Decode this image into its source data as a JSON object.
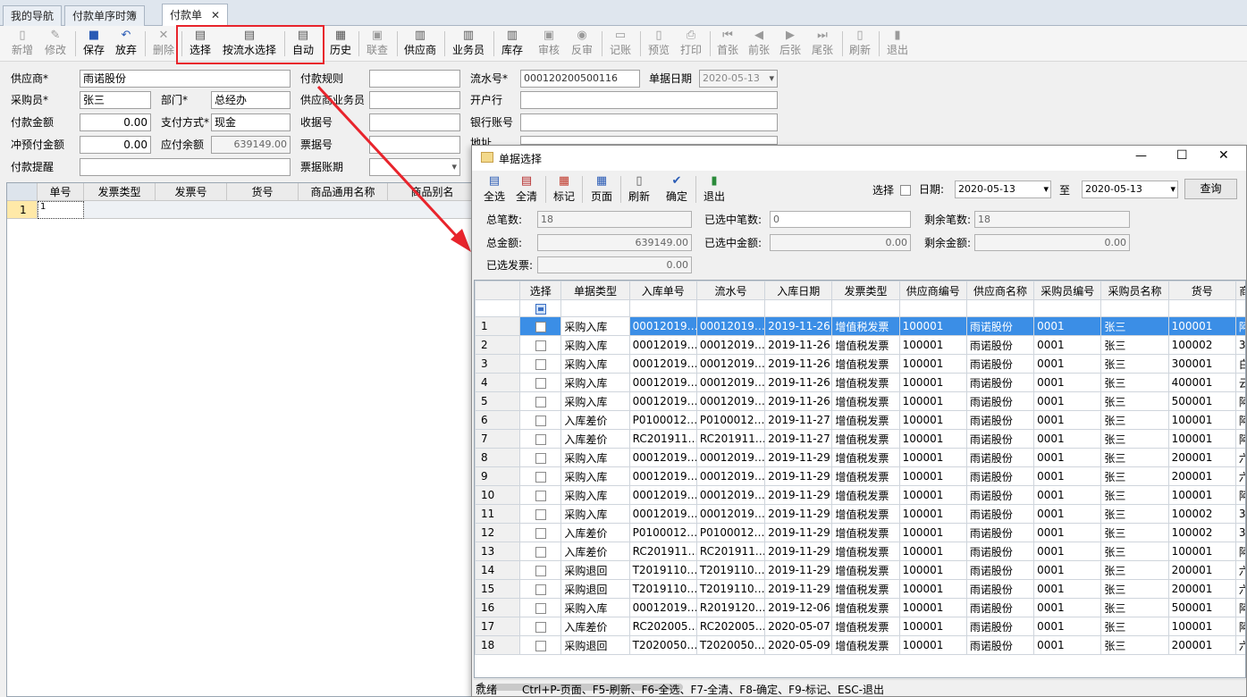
{
  "tabs": [
    {
      "label": "我的导航"
    },
    {
      "label": "付款单序时簿"
    },
    {
      "label": "付款单",
      "close": "✕"
    }
  ],
  "toolbar": {
    "items": [
      {
        "label": "新增",
        "icon": "new-doc-icon"
      },
      {
        "label": "修改",
        "icon": "edit-doc-icon"
      },
      {
        "label": "保存",
        "icon": "save-icon"
      },
      {
        "label": "放弃",
        "icon": "undo-icon"
      },
      {
        "label": "删除",
        "icon": "delete-icon"
      },
      {
        "label": "选择",
        "icon": "select-icon"
      },
      {
        "label": "按流水选择",
        "icon": "select-serial-icon"
      },
      {
        "label": "自动",
        "icon": "auto-icon"
      },
      {
        "label": "历史",
        "icon": "history-icon"
      },
      {
        "label": "联查",
        "icon": "link-query-icon"
      },
      {
        "label": "供应商",
        "icon": "supplier-icon"
      },
      {
        "label": "业务员",
        "icon": "salesman-icon"
      },
      {
        "label": "库存",
        "icon": "stock-icon"
      },
      {
        "label": "审核",
        "icon": "audit-icon"
      },
      {
        "label": "反审",
        "icon": "unaudit-icon"
      },
      {
        "label": "记账",
        "icon": "post-icon"
      },
      {
        "label": "预览",
        "icon": "preview-icon"
      },
      {
        "label": "打印",
        "icon": "print-icon"
      },
      {
        "label": "首张",
        "icon": "first-icon"
      },
      {
        "label": "前张",
        "icon": "prev-icon"
      },
      {
        "label": "后张",
        "icon": "next-icon"
      },
      {
        "label": "尾张",
        "icon": "last-icon"
      },
      {
        "label": "刷新",
        "icon": "refresh-icon"
      },
      {
        "label": "退出",
        "icon": "exit-icon"
      }
    ]
  },
  "form": {
    "supplier_label": "供应商*",
    "supplier_value": "雨诺股份",
    "pay_rule_label": "付款规则",
    "pay_rule_value": "",
    "serial_label": "流水号*",
    "serial_value": "000120200500116",
    "date_label": "单据日期",
    "date_value": "2020-05-13",
    "buyer_label": "采购员*",
    "buyer_value": "张三",
    "dept_label": "部门*",
    "dept_value": "总经办",
    "supplier_sales_label": "供应商业务员",
    "supplier_sales_value": "",
    "bank_label": "开户行",
    "bank_value": "",
    "amount_label": "付款金额",
    "amount_value": "0.00",
    "pay_method_label": "支付方式*",
    "pay_method_value": "现金",
    "receipt_label": "收据号",
    "receipt_value": "",
    "bank_account_label": "银行账号",
    "bank_account_value": "",
    "offset_label": "冲预付金额",
    "offset_value": "0.00",
    "payable_label": "应付余额",
    "payable_value": "639149.00",
    "bill_no_label": "票据号",
    "bill_no_value": "",
    "address_label": "地址",
    "address_value": "",
    "reminder_label": "付款提醒",
    "reminder_value": "",
    "bill_period_label": "票据账期",
    "bill_period_value": ""
  },
  "left_grid": {
    "columns": [
      "单号",
      "发票类型",
      "发票号",
      "货号",
      "商品通用名称",
      "商品别名"
    ],
    "rows": [
      {
        "num": "1",
        "cell": "1"
      }
    ]
  },
  "dialog": {
    "title": "单据选择",
    "window_controls": {
      "minimize": "—",
      "maximize": "☐",
      "close": "✕"
    },
    "toolbar": [
      {
        "label": "全选",
        "icon": "select-all-icon"
      },
      {
        "label": "全清",
        "icon": "clear-all-icon"
      },
      {
        "label": "标记",
        "icon": "mark-icon"
      },
      {
        "label": "页面",
        "icon": "page-icon"
      },
      {
        "label": "刷新",
        "icon": "refresh-icon"
      },
      {
        "label": "确定",
        "icon": "confirm-icon"
      },
      {
        "label": "退出",
        "icon": "exit-icon"
      }
    ],
    "select_label": "选择",
    "date_label": "日期:",
    "date_from": "2020-05-13",
    "to_label": "至",
    "date_to": "2020-05-13",
    "query_label": "查询",
    "total_count_label": "总笔数:",
    "total_count": "18",
    "selected_count_label": "已选中笔数:",
    "selected_count": "0",
    "remain_count_label": "剩余笔数:",
    "remain_count": "18",
    "total_amount_label": "总金额:",
    "total_amount": "639149.00",
    "selected_amount_label": "已选中金额:",
    "selected_amount": "0.00",
    "remain_amount_label": "剩余金额:",
    "remain_amount": "0.00",
    "selected_invoice_label": "已选发票:",
    "selected_invoice": "0.00",
    "columns": [
      "选择",
      "单据类型",
      "入库单号",
      "流水号",
      "入库日期",
      "发票类型",
      "供应商编号",
      "供应商名称",
      "采购员编号",
      "采购员名称",
      "货号",
      "商"
    ],
    "rows": [
      {
        "n": "1",
        "type": "采购入库",
        "in_no": "00012019…",
        "serial": "00012019…",
        "date": "2019-11-26",
        "inv": "增值税发票",
        "sup_code": "100001",
        "sup_name": "雨诺股份",
        "buyer_code": "0001",
        "buyer_name": "张三",
        "item": "100001",
        "extra": "阿"
      },
      {
        "n": "2",
        "type": "采购入库",
        "in_no": "00012019…",
        "serial": "00012019…",
        "date": "2019-11-26",
        "inv": "增值税发票",
        "sup_code": "100001",
        "sup_name": "雨诺股份",
        "buyer_code": "0001",
        "buyer_name": "张三",
        "item": "100002",
        "extra": "30"
      },
      {
        "n": "3",
        "type": "采购入库",
        "in_no": "00012019…",
        "serial": "00012019…",
        "date": "2019-11-26",
        "inv": "增值税发票",
        "sup_code": "100001",
        "sup_name": "雨诺股份",
        "buyer_code": "0001",
        "buyer_name": "张三",
        "item": "300001",
        "extra": "白"
      },
      {
        "n": "4",
        "type": "采购入库",
        "in_no": "00012019…",
        "serial": "00012019…",
        "date": "2019-11-26",
        "inv": "增值税发票",
        "sup_code": "100001",
        "sup_name": "雨诺股份",
        "buyer_code": "0001",
        "buyer_name": "张三",
        "item": "400001",
        "extra": "云"
      },
      {
        "n": "5",
        "type": "采购入库",
        "in_no": "00012019…",
        "serial": "00012019…",
        "date": "2019-11-26",
        "inv": "增值税发票",
        "sup_code": "100001",
        "sup_name": "雨诺股份",
        "buyer_code": "0001",
        "buyer_name": "张三",
        "item": "500001",
        "extra": "阿"
      },
      {
        "n": "6",
        "type": "入库差价",
        "in_no": "P0100012…",
        "serial": "P0100012…",
        "date": "2019-11-27",
        "inv": "增值税发票",
        "sup_code": "100001",
        "sup_name": "雨诺股份",
        "buyer_code": "0001",
        "buyer_name": "张三",
        "item": "100001",
        "extra": "阿"
      },
      {
        "n": "7",
        "type": "入库差价",
        "in_no": "RC201911…",
        "serial": "RC201911…",
        "date": "2019-11-27",
        "inv": "增值税发票",
        "sup_code": "100001",
        "sup_name": "雨诺股份",
        "buyer_code": "0001",
        "buyer_name": "张三",
        "item": "100001",
        "extra": "阿"
      },
      {
        "n": "8",
        "type": "采购入库",
        "in_no": "00012019…",
        "serial": "00012019…",
        "date": "2019-11-29",
        "inv": "增值税发票",
        "sup_code": "100001",
        "sup_name": "雨诺股份",
        "buyer_code": "0001",
        "buyer_name": "张三",
        "item": "200001",
        "extra": "六"
      },
      {
        "n": "9",
        "type": "采购入库",
        "in_no": "00012019…",
        "serial": "00012019…",
        "date": "2019-11-29",
        "inv": "增值税发票",
        "sup_code": "100001",
        "sup_name": "雨诺股份",
        "buyer_code": "0001",
        "buyer_name": "张三",
        "item": "200001",
        "extra": "六"
      },
      {
        "n": "10",
        "type": "采购入库",
        "in_no": "00012019…",
        "serial": "00012019…",
        "date": "2019-11-29",
        "inv": "增值税发票",
        "sup_code": "100001",
        "sup_name": "雨诺股份",
        "buyer_code": "0001",
        "buyer_name": "张三",
        "item": "100001",
        "extra": "阿"
      },
      {
        "n": "11",
        "type": "采购入库",
        "in_no": "00012019…",
        "serial": "00012019…",
        "date": "2019-11-29",
        "inv": "增值税发票",
        "sup_code": "100001",
        "sup_name": "雨诺股份",
        "buyer_code": "0001",
        "buyer_name": "张三",
        "item": "100002",
        "extra": "30"
      },
      {
        "n": "12",
        "type": "入库差价",
        "in_no": "P0100012…",
        "serial": "P0100012…",
        "date": "2019-11-29",
        "inv": "增值税发票",
        "sup_code": "100001",
        "sup_name": "雨诺股份",
        "buyer_code": "0001",
        "buyer_name": "张三",
        "item": "100002",
        "extra": "30"
      },
      {
        "n": "13",
        "type": "入库差价",
        "in_no": "RC201911…",
        "serial": "RC201911…",
        "date": "2019-11-29",
        "inv": "增值税发票",
        "sup_code": "100001",
        "sup_name": "雨诺股份",
        "buyer_code": "0001",
        "buyer_name": "张三",
        "item": "100001",
        "extra": "阿"
      },
      {
        "n": "14",
        "type": "采购退回",
        "in_no": "T2019110…",
        "serial": "T2019110…",
        "date": "2019-11-29",
        "inv": "增值税发票",
        "sup_code": "100001",
        "sup_name": "雨诺股份",
        "buyer_code": "0001",
        "buyer_name": "张三",
        "item": "200001",
        "extra": "六"
      },
      {
        "n": "15",
        "type": "采购退回",
        "in_no": "T2019110…",
        "serial": "T2019110…",
        "date": "2019-11-29",
        "inv": "增值税发票",
        "sup_code": "100001",
        "sup_name": "雨诺股份",
        "buyer_code": "0001",
        "buyer_name": "张三",
        "item": "200001",
        "extra": "六"
      },
      {
        "n": "16",
        "type": "采购入库",
        "in_no": "00012019…",
        "serial": "R2019120…",
        "date": "2019-12-06",
        "inv": "增值税发票",
        "sup_code": "100001",
        "sup_name": "雨诺股份",
        "buyer_code": "0001",
        "buyer_name": "张三",
        "item": "500001",
        "extra": "阿"
      },
      {
        "n": "17",
        "type": "入库差价",
        "in_no": "RC202005…",
        "serial": "RC202005…",
        "date": "2020-05-07",
        "inv": "增值税发票",
        "sup_code": "100001",
        "sup_name": "雨诺股份",
        "buyer_code": "0001",
        "buyer_name": "张三",
        "item": "100001",
        "extra": "阿"
      },
      {
        "n": "18",
        "type": "采购退回",
        "in_no": "T2020050…",
        "serial": "T2020050…",
        "date": "2020-05-09",
        "inv": "增值税发票",
        "sup_code": "100001",
        "sup_name": "雨诺股份",
        "buyer_code": "0001",
        "buyer_name": "张三",
        "item": "200001",
        "extra": "六"
      }
    ],
    "status_ready": "就绪",
    "status_hint": "Ctrl+P-页面、F5-刷新、F6-全选、F7-全清、F8-确定、F9-标记、ESC-退出"
  },
  "colors": {
    "highlight": "#e8242c",
    "selected_row": "#3b8ee6"
  }
}
